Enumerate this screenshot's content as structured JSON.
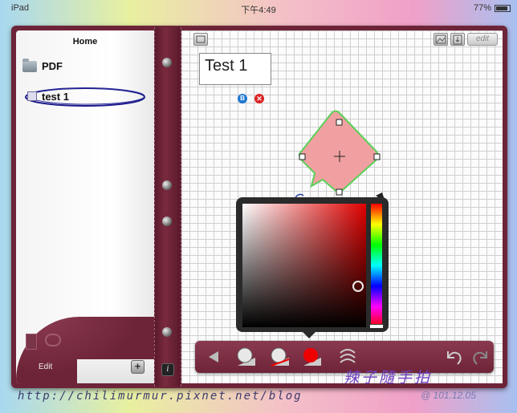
{
  "status_bar": {
    "device": "iPad",
    "time": "下午4:49",
    "battery": "77%"
  },
  "sidebar": {
    "title": "Home",
    "items": [
      {
        "label": "PDF",
        "icon": "folder-icon"
      },
      {
        "label": "test 1",
        "icon": "note-icon",
        "selected": true
      }
    ],
    "edit_label": "Edit",
    "add_label": "+"
  },
  "spine": {
    "info_label": "i"
  },
  "canvas": {
    "edit_label": "edit",
    "title_text": "Test 1",
    "badge_blue_label": "B",
    "badge_red_label": "✕"
  },
  "color_picker": {
    "base_hue": "#e00000",
    "hue_colors": [
      "#ff0000",
      "#ffff00",
      "#00ff00",
      "#00ffff",
      "#0000ff",
      "#ff00ff"
    ]
  },
  "shape": {
    "fill": "#f0a0a0",
    "stroke": "#5ad05a"
  },
  "toolbar": {
    "icons": [
      "back-arrow-icon",
      "fill-shape-icon",
      "line-shape-icon",
      "color-shape-icon",
      "style-icon",
      "undo-icon",
      "redo-icon"
    ]
  },
  "watermark": {
    "url": "http://chilimurmur.pixnet.net/blog",
    "signature": "辣子隨手拍",
    "date": "@ 101.12.05"
  }
}
